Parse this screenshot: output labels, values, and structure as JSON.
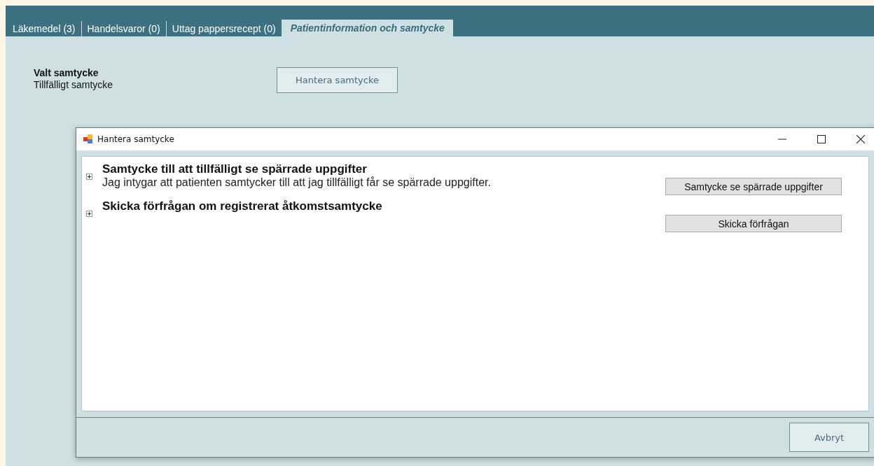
{
  "tabs": [
    {
      "label": "Läkemedel (3)",
      "selected": false
    },
    {
      "label": "Handelsvaror (0)",
      "selected": false
    },
    {
      "label": "Uttag pappersrecept (0)",
      "selected": false
    },
    {
      "label": "Patientinformation och samtycke",
      "selected": true
    }
  ],
  "consent": {
    "label": "Valt samtycke",
    "value": "Tillfälligt samtycke",
    "button": "Hantera samtycke"
  },
  "dialog": {
    "title": "Hantera samtycke",
    "sections": [
      {
        "title": "Samtycke till att tillfälligt se spärrade uppgifter",
        "description": "Jag intygar att patienten samtycker till att jag tillfälligt får se spärrade uppgifter.",
        "button": "Samtycke se spärrade uppgifter",
        "expanded": false
      },
      {
        "title": "Skicka förfrågan om registrerat åtkomstsamtycke",
        "button": "Skicka förfrågan",
        "expanded": false
      }
    ],
    "cancel_button": "Avbryt"
  }
}
